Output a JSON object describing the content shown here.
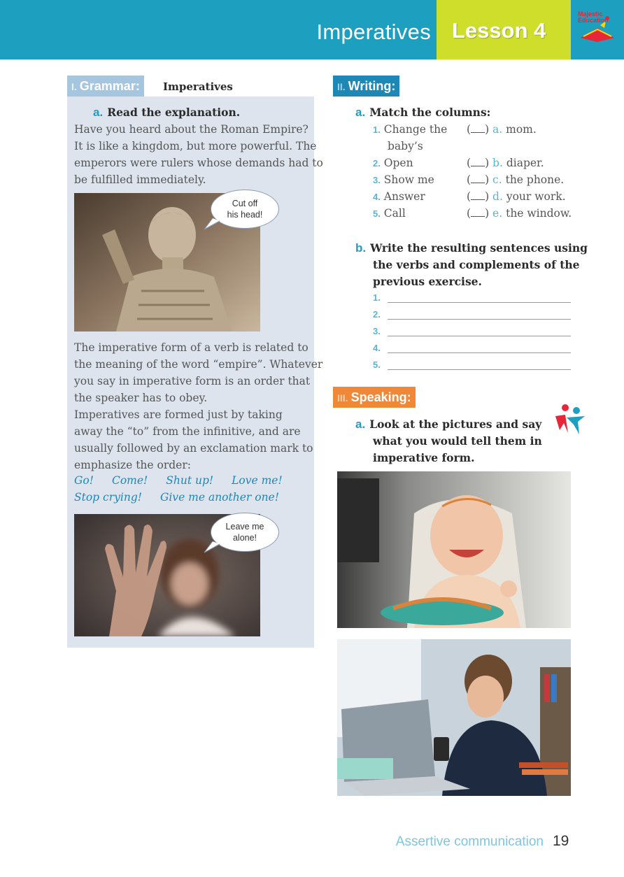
{
  "header": {
    "title": "Imperatives",
    "lesson": "Lesson 4",
    "logo_text_1": "Majestic",
    "logo_text_2": "Education",
    "colors": {
      "bar": "#1d9fbf",
      "lesson_box": "#cfde2a"
    }
  },
  "grammar": {
    "num": "I.",
    "label": "Grammar:",
    "subtitle": "Imperatives",
    "item_letter": "a.",
    "item_title": "Read the explanation.",
    "para1": [
      "Have you heard about the Roman Empire?",
      "It is like a kingdom, but more powerful. The",
      "emperors were rulers whose demands had to",
      "be fulfilled immediately."
    ],
    "bubble1": [
      "Cut off",
      "his head!"
    ],
    "para2": [
      "The imperative form of a verb is related to",
      "the meaning of the word “empire”. Whatever",
      "you say in imperative form is an order that",
      "the speaker has to obey.",
      "Imperatives are formed just by taking",
      "away the “to” from the infinitive, and are",
      "usually followed by an exclamation mark to",
      "emphasize the order:"
    ],
    "examples_row1": [
      "Go!",
      "Come!",
      "Shut up!",
      "Love me!"
    ],
    "examples_row2": [
      "Stop crying!",
      "Give me another one!"
    ],
    "bubble2": [
      "Leave me",
      "alone!"
    ]
  },
  "writing": {
    "num": "II.",
    "label": "Writing:",
    "a_letter": "a.",
    "a_title": "Match the columns:",
    "left_items": [
      {
        "n": "1.",
        "text": "Change the"
      },
      {
        "n": "2.",
        "text": "Open"
      },
      {
        "n": "3.",
        "text": "Show me"
      },
      {
        "n": "4.",
        "text": "Answer"
      },
      {
        "n": "5.",
        "text": "Call"
      }
    ],
    "left_item1_cont": "baby’s",
    "right_items": [
      {
        "l": "a.",
        "text": "mom."
      },
      {
        "l": "b.",
        "text": "diaper."
      },
      {
        "l": "c.",
        "text": "the phone."
      },
      {
        "l": "d.",
        "text": "your work."
      },
      {
        "l": "e.",
        "text": "the window."
      }
    ],
    "b_letter": "b.",
    "b_title": [
      "Write the resulting sentences using",
      "the verbs and complements of the",
      "previous exercise."
    ],
    "lines": [
      "1.",
      "2.",
      "3.",
      "4.",
      "5."
    ]
  },
  "speaking": {
    "num": "III.",
    "label": "Speaking:",
    "a_letter": "a.",
    "a_title": [
      "Look at the pictures and say",
      "what you would tell them in",
      "imperative form."
    ]
  },
  "footer": {
    "section": "Assertive communication",
    "page": "19"
  }
}
